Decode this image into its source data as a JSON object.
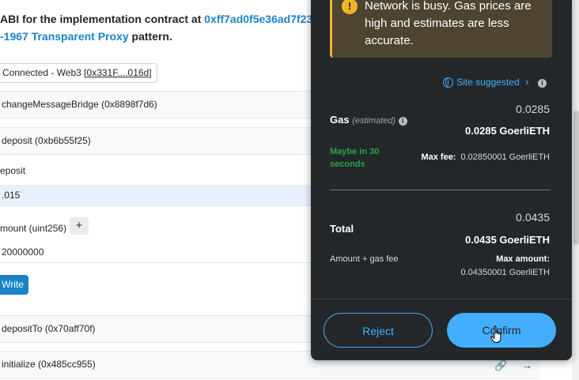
{
  "title": {
    "line1_text": "ABI for the implementation contract at ",
    "line1_addr": "0xff7ad0f5e36ad7f23",
    "line2_link": "-1967 Transparent Proxy",
    "line2_rest": " pattern."
  },
  "connection": {
    "label": "Connected - Web3 [",
    "address": "0x331F....016d",
    "close": "]"
  },
  "functions": {
    "f1": "changeMessageBridge (0x8898f7d6)",
    "f2": "deposit (0xb6b55f25)",
    "f3": "depositTo (0x70aff70f)",
    "f4": "initialize (0x485cc955)"
  },
  "deposit_form": {
    "payable_label": "eposit",
    "payable_value": ".015",
    "amount_label": "mount (uint256)",
    "plus": "+",
    "amount_value": "20000000",
    "write_label": "Write"
  },
  "popup": {
    "warning_icon": "!",
    "warning_text": "Network is busy. Gas prices are high and estimates are less accurate.",
    "site_suggested": "Site suggested",
    "site_chevron": "›",
    "info_glyph": "i",
    "gas_fiat": "0.0285",
    "gas_label": "Gas",
    "gas_estimated": "(estimated)",
    "gas_eth": "0.0285 GoerliETH",
    "maybe_in": "Maybe in 30 seconds",
    "max_fee_label": "Max fee:",
    "max_fee_value": "0.02850001 GoerliETH",
    "total_fiat": "0.0435",
    "total_label": "Total",
    "total_eth": "0.0435 GoerliETH",
    "amount_gas": "Amount + gas fee",
    "max_amount_label": "Max amount:",
    "max_amount_value": "0.04350001 GoerliETH",
    "reject_label": "Reject",
    "confirm_label": "Confirm"
  },
  "colors": {
    "accent_blue": "#43aefc",
    "warning_yellow": "#f0b429",
    "success_green": "#28a745",
    "popup_bg": "#24272a",
    "link_blue": "#1b84c5"
  },
  "icons": {
    "warning": "warning-icon",
    "globe": "globe-icon",
    "info": "info-icon",
    "link": "link-icon",
    "arrow": "arrow-right-icon",
    "cursor": "hand-cursor-icon"
  },
  "icon_glyphs": {
    "link": "🔗",
    "arrow": "→"
  }
}
